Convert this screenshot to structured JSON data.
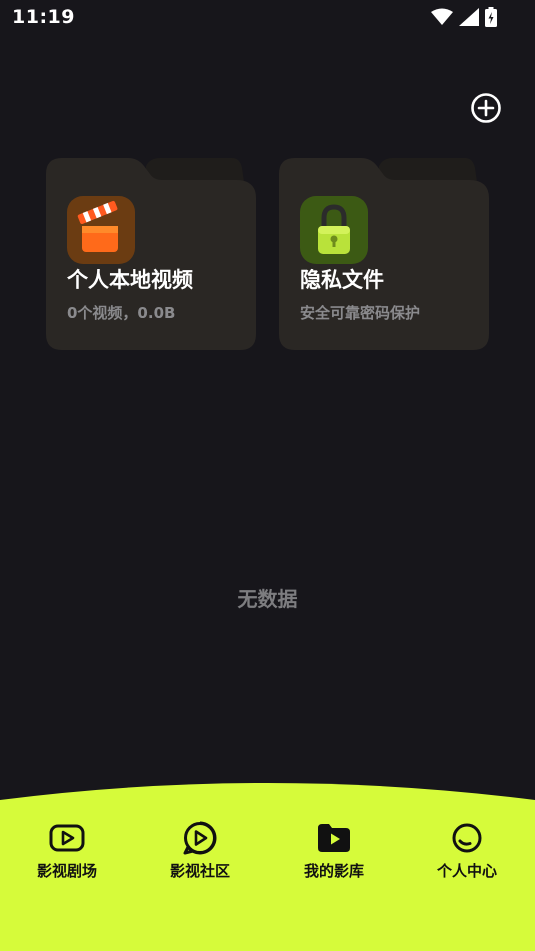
{
  "status_bar": {
    "time": "11:19"
  },
  "cards": [
    {
      "title": "个人本地视频",
      "subtitle": "0个视频，0.0B",
      "icon": "clapperboard-icon"
    },
    {
      "title": "隐私文件",
      "subtitle": "安全可靠密码保护",
      "icon": "padlock-icon"
    }
  ],
  "empty_state": "无数据",
  "bottom_nav": [
    {
      "label": "影视剧场",
      "icon": "tv-play-icon"
    },
    {
      "label": "影视社区",
      "icon": "chat-play-icon"
    },
    {
      "label": "我的影库",
      "icon": "folder-play-icon",
      "active": true
    },
    {
      "label": "个人中心",
      "icon": "profile-circle-icon"
    }
  ],
  "colors": {
    "background": "#17161b",
    "card": "#2a2724",
    "accent": "#d6fb3a",
    "muted_text": "#8a8a8d"
  }
}
